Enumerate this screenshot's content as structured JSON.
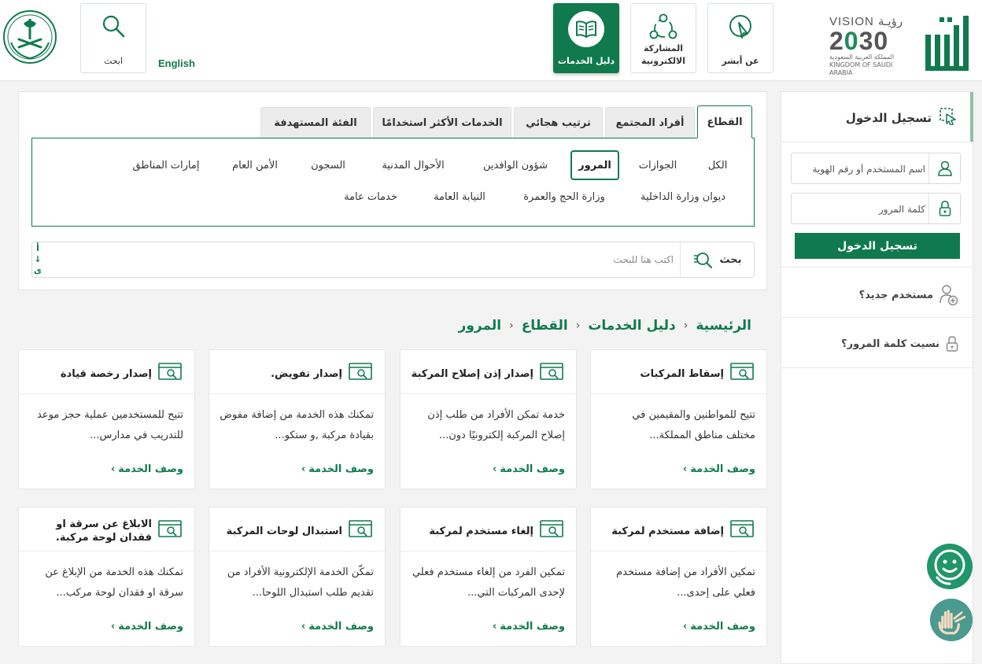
{
  "header": {
    "english": "English",
    "search_label": "ابحث",
    "nav": [
      {
        "label": "عن أبشر"
      },
      {
        "label": "المشاركة الالكترونية"
      },
      {
        "label": "دليل الخدمات"
      }
    ],
    "vision": {
      "top": "VISION رؤيـة",
      "year_left": "2",
      "year_mid": "0",
      "year_right": "30",
      "kingdom_ar": "المملكة العربية السعودية",
      "kingdom_en": "KINGDOM OF SAUDI ARABIA"
    }
  },
  "login": {
    "title": "تسجيل الدخول",
    "username_placeholder": "اسم المستخدم أو رقم الهوية",
    "password_placeholder": "كلمة المرور",
    "submit": "تسجيل الدخول",
    "new_user": "مستخدم جديد؟",
    "forgot": "نسيت كلمة المرور؟"
  },
  "tabs": [
    "القطاع",
    "أفراد المجتمع",
    "ترتيب هجائي",
    "الخدمات الأكثر استخدامًا",
    "الفئة المستهدفة"
  ],
  "categories_row1": [
    "الكل",
    "الجوازات",
    "المرور",
    "شؤون الوافدين",
    "الأحوال المدنية",
    "السجون",
    "الأمن العام",
    "إمارات المناطق"
  ],
  "categories_row2": [
    "ديوان وزارة الداخلية",
    "وزارة الحج والعمرة",
    "النيابة العامة",
    "خدمات عامة"
  ],
  "search": {
    "button": "بحث",
    "placeholder": "اكتب هنا للبحث",
    "arrows": "أ ↓ ى"
  },
  "breadcrumb": [
    "الرئيسية",
    "دليل الخدمات",
    "القطاع",
    "المرور"
  ],
  "link_label": "وصف الخدمة",
  "cards": [
    {
      "title": "إسقاط المركبات",
      "desc": "تتيح للمواطنين والمقيمين في مختلف مناطق المملكة..."
    },
    {
      "title": "إصدار إذن إصلاح المركبة",
      "desc": "خدمة تمكن الأفراد من طلب إذن إصلاح المركبة إلكترونيًا دون..."
    },
    {
      "title": "إصدار تفويض.",
      "desc": "تمكنك هذه الخدمة من إضافة مفوض بقيادة مركبة ,و ستكو..."
    },
    {
      "title": "إصدار رخصة قيادة",
      "desc": "تتيح للمستخدمين عملية حجز موعد للتدريب في مدارس..."
    },
    {
      "title": "إضافة مستخدم لمركبة",
      "desc": "تمكين الأفراد من إضافة مستخدم فعلي على إحدى..."
    },
    {
      "title": "إلغاء مستخدم لمركبة",
      "desc": "تمكين الفرد من إلغاء مستخدم فعلي لإحدى المركبات التي..."
    },
    {
      "title": "استبدال لوحات المركبة",
      "desc": "تمكّن الخدمة الإلكترونية الأفراد من تقديم طلب استبدال اللوحا..."
    },
    {
      "title": "الابلاغ عن سرقة او فقدان لوحة مركبة.",
      "desc": "تمكنك هذه الخدمة من الإبلاغ عن سرقة او فقدان لوحة مركب..."
    }
  ],
  "colors": {
    "primary": "#107a4e",
    "accent": "#8fc3a3"
  }
}
